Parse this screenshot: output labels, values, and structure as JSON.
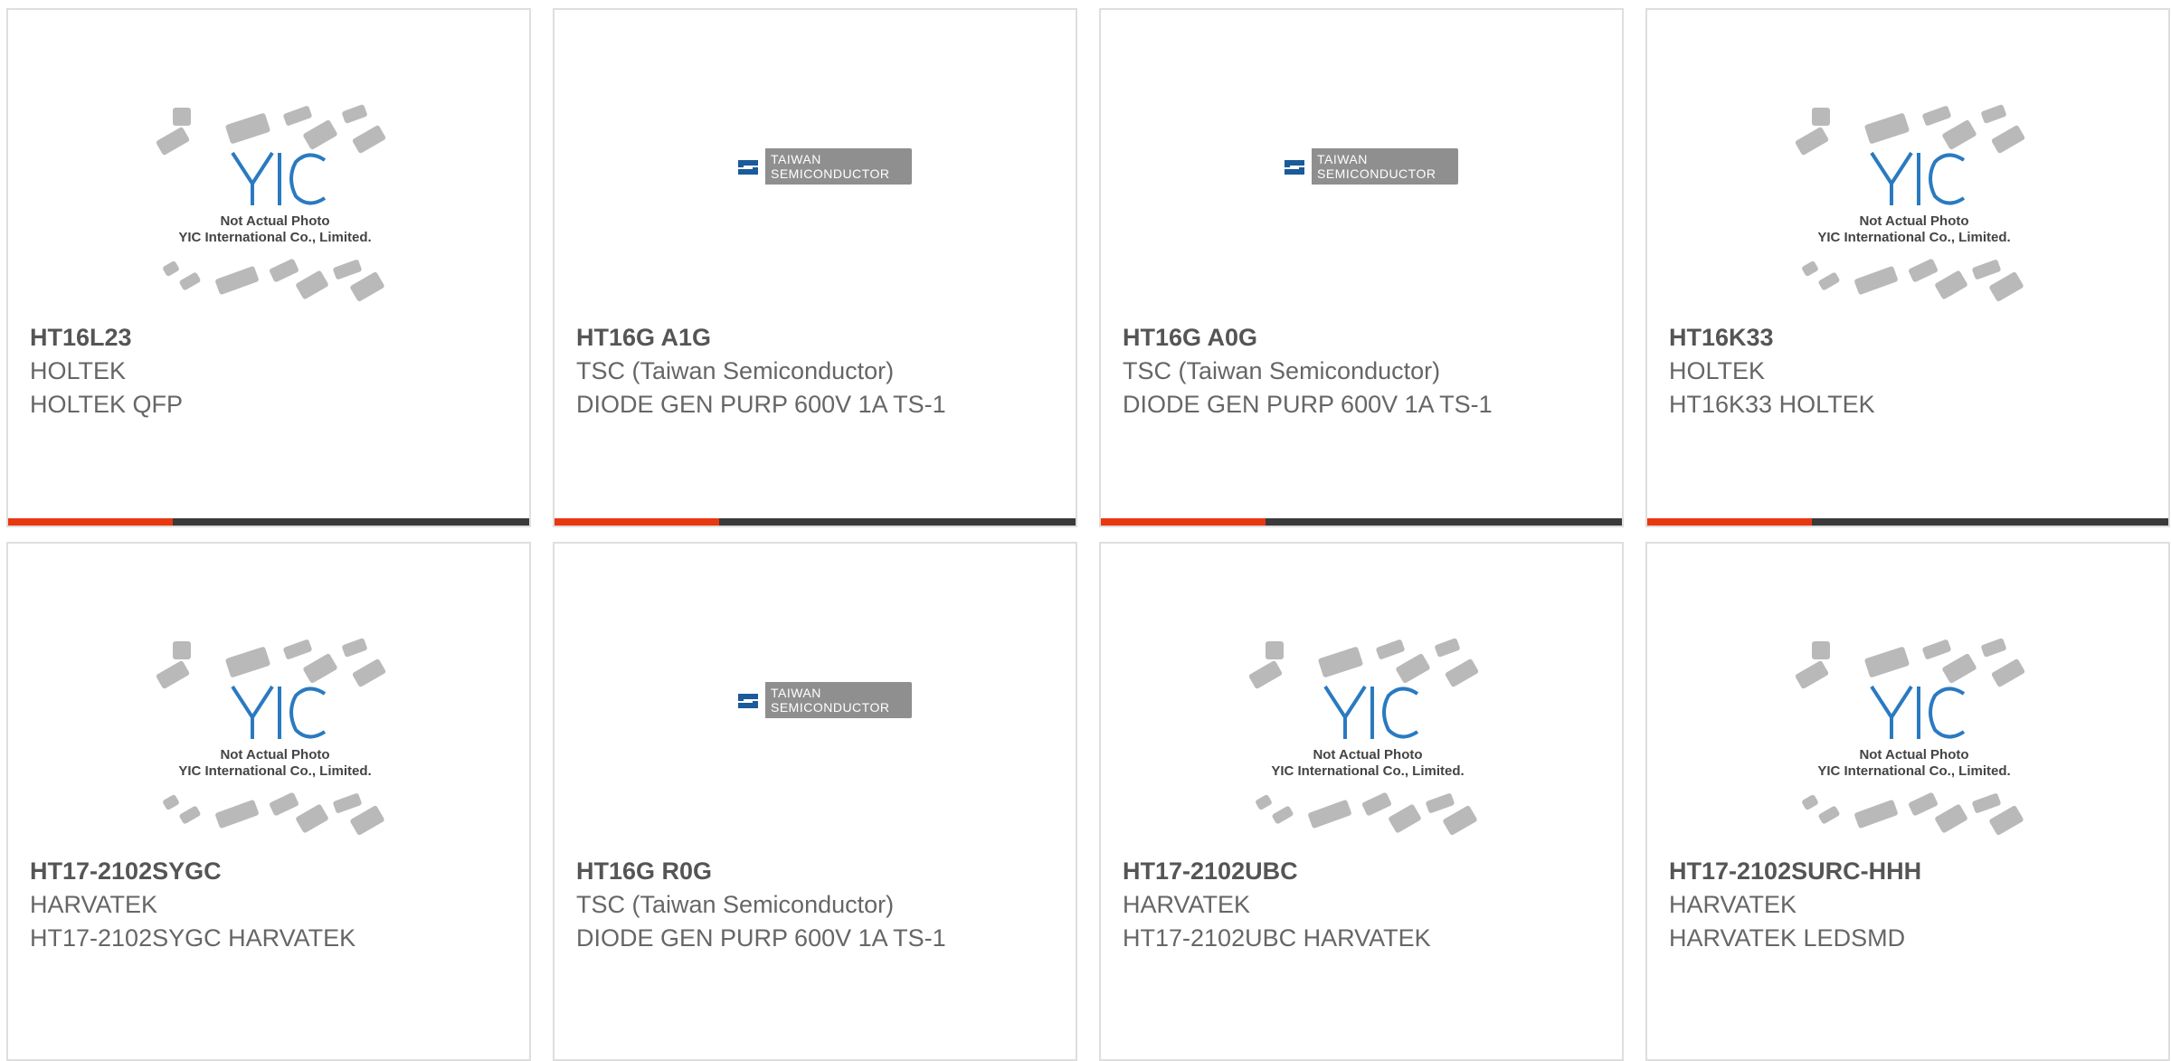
{
  "placeholder_text": [
    "Not Actual Photo",
    "YIC International Co., Limited."
  ],
  "tsc_logo_text": [
    "TAIWAN",
    "SEMICONDUCTOR"
  ],
  "colors": {
    "accent": "#e8380f",
    "bar": "#3a3a3a",
    "yic_blue": "#2a7ac0"
  },
  "products": [
    {
      "part": "HT16L23",
      "manufacturer": "HOLTEK",
      "description": "HOLTEK QFP",
      "image": "yic-placeholder-icon"
    },
    {
      "part": "HT16G A1G",
      "manufacturer": "TSC (Taiwan Semiconductor)",
      "description": "DIODE GEN PURP 600V 1A TS-1",
      "image": "tsc-logo-icon"
    },
    {
      "part": "HT16G A0G",
      "manufacturer": "TSC (Taiwan Semiconductor)",
      "description": "DIODE GEN PURP 600V 1A TS-1",
      "image": "tsc-logo-icon"
    },
    {
      "part": "HT16K33",
      "manufacturer": "HOLTEK",
      "description": "HT16K33 HOLTEK",
      "image": "yic-placeholder-icon"
    },
    {
      "part": "HT17-2102SYGC",
      "manufacturer": "HARVATEK",
      "description": "HT17-2102SYGC HARVATEK",
      "image": "yic-placeholder-icon"
    },
    {
      "part": "HT16G R0G",
      "manufacturer": "TSC (Taiwan Semiconductor)",
      "description": "DIODE GEN PURP 600V 1A TS-1",
      "image": "tsc-logo-icon"
    },
    {
      "part": "HT17-2102UBC",
      "manufacturer": "HARVATEK",
      "description": "HT17-2102UBC HARVATEK",
      "image": "yic-placeholder-icon"
    },
    {
      "part": "HT17-2102SURC-HHH",
      "manufacturer": "HARVATEK",
      "description": "HARVATEK LEDSMD",
      "image": "yic-placeholder-icon"
    }
  ]
}
